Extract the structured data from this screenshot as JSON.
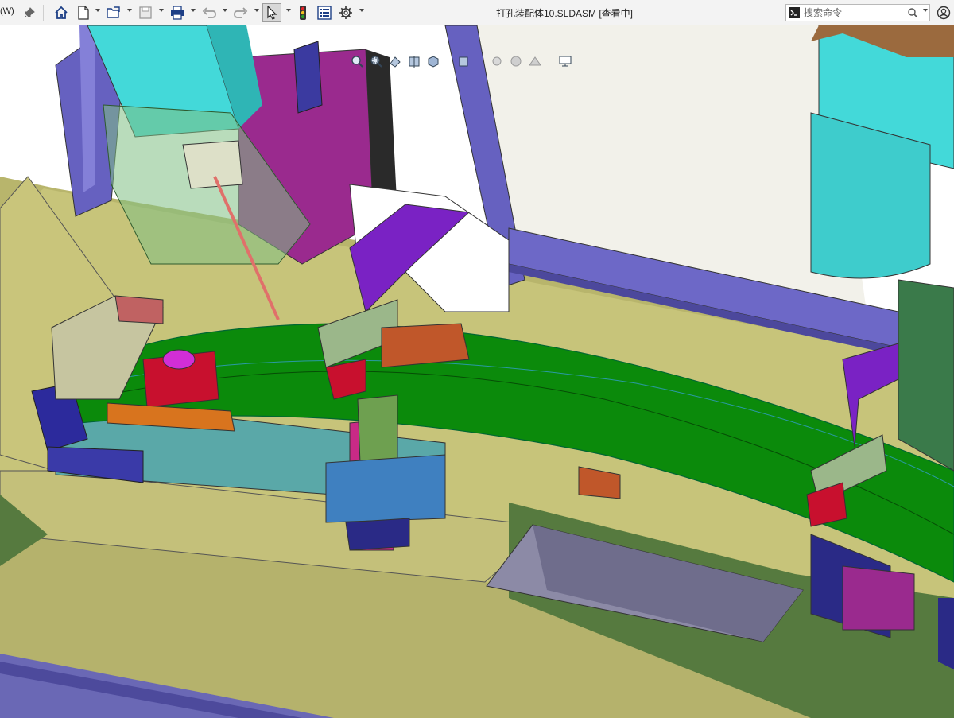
{
  "window": {
    "title": "打孔装配体10.SLDASM [查看中]",
    "menu_stub_label": "(W)"
  },
  "toolbar": {
    "pin_icon": "pin-icon",
    "items": [
      {
        "name": "home-icon"
      },
      {
        "name": "new-document-icon"
      },
      {
        "name": "open-folder-icon"
      },
      {
        "name": "save-icon"
      },
      {
        "name": "print-icon"
      },
      {
        "name": "undo-icon"
      },
      {
        "name": "redo-icon"
      },
      {
        "name": "select-cursor-icon"
      },
      {
        "name": "traffic-light-icon"
      },
      {
        "name": "file-properties-icon"
      },
      {
        "name": "options-gear-icon"
      }
    ]
  },
  "search": {
    "placeholder": "搜索命令",
    "icon": "search-icon"
  },
  "heads_up_toolbar": {
    "items": [
      "zoom-to-fit-icon",
      "zoom-area-icon",
      "previous-view-icon",
      "section-view-icon",
      "view-orientation-icon",
      "display-style-icon",
      "hide-show-icon",
      "edit-appearance-icon",
      "apply-scene-icon",
      "view-settings-icon"
    ]
  },
  "colors": {
    "green_part": "#0b8a0b",
    "floor_khaki": "#c7c47a",
    "frame_blue": "#5a56b8",
    "cyan_motor": "#43d9d9",
    "purple_clamp": "#8a2bc9",
    "magenta_plate": "#9a2a8e",
    "red_block": "#c8102e"
  }
}
